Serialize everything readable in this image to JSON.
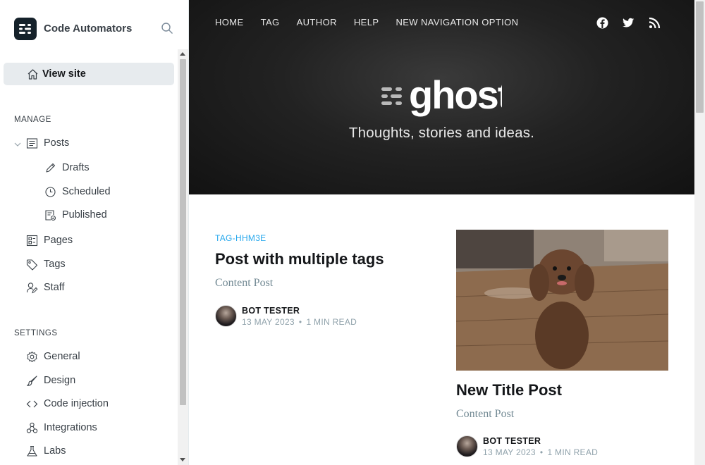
{
  "brand": {
    "name": "Code Automators",
    "logo_icon": "ghost-brand-icon"
  },
  "sidebar": {
    "view_site": "View site",
    "manage_title": "MANAGE",
    "manage": [
      {
        "label": "Posts",
        "icon": "posts-icon"
      },
      {
        "label": "Drafts",
        "icon": "pencil-icon"
      },
      {
        "label": "Scheduled",
        "icon": "clock-icon"
      },
      {
        "label": "Published",
        "icon": "published-icon"
      },
      {
        "label": "Pages",
        "icon": "pages-icon"
      },
      {
        "label": "Tags",
        "icon": "tag-icon"
      },
      {
        "label": "Staff",
        "icon": "staff-icon"
      }
    ],
    "settings_title": "SETTINGS",
    "settings": [
      {
        "label": "General",
        "icon": "gear-icon"
      },
      {
        "label": "Design",
        "icon": "brush-icon"
      },
      {
        "label": "Code injection",
        "icon": "code-icon"
      },
      {
        "label": "Integrations",
        "icon": "integrations-icon"
      },
      {
        "label": "Labs",
        "icon": "flask-icon"
      }
    ]
  },
  "site": {
    "nav": [
      "HOME",
      "TAG",
      "AUTHOR",
      "HELP",
      "NEW NAVIGATION OPTION"
    ],
    "logo_text": "ghost",
    "description": "Thoughts, stories and ideas."
  },
  "posts": [
    {
      "tag": "TAG-HHM3E",
      "title": "Post with multiple tags",
      "excerpt": "Content Post",
      "author": "BOT TESTER",
      "date": "13 MAY 2023",
      "read_time": "1 MIN READ"
    },
    {
      "title": "New Title Post",
      "excerpt": "Content Post",
      "author": "BOT TESTER",
      "date": "13 MAY 2023",
      "read_time": "1 MIN READ"
    }
  ],
  "colors": {
    "accent": "#26a8ed",
    "sidebar_active": "#e7ebee",
    "hero_bg": "#1f1f1f"
  }
}
